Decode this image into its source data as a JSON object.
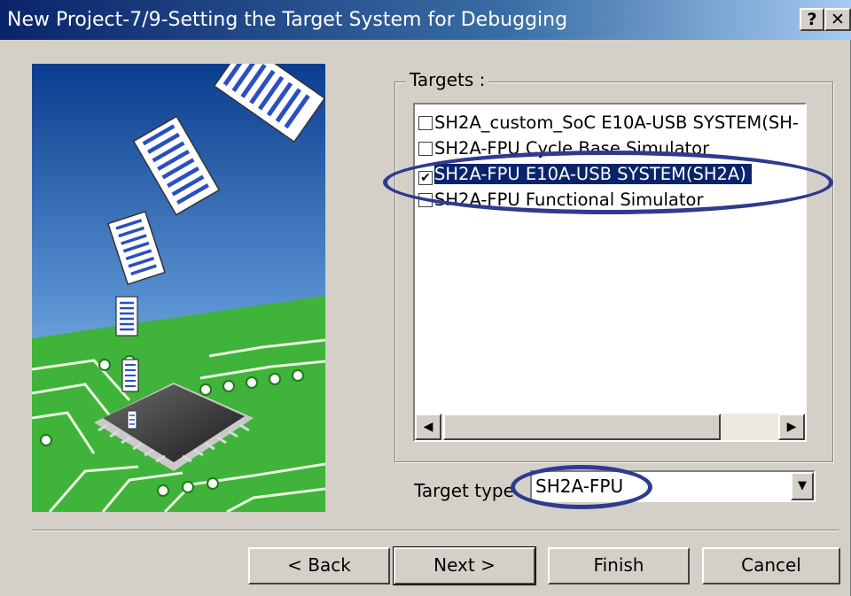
{
  "window": {
    "title": "New Project-7/9-Setting the Target System for Debugging",
    "help_label": "?",
    "close_label": "✕"
  },
  "illustration": {
    "icon": "documents-to-chip-illustration",
    "colors": {
      "sky_top": "#0a3d8f",
      "sky_bottom": "#cfe3f5",
      "board": "#3fb33a",
      "chip": "#3a3a3a"
    }
  },
  "targets": {
    "group_label": "Targets :",
    "items": [
      {
        "label": "SH2A_custom_SoC E10A-USB SYSTEM(SH-",
        "checked": false,
        "selected": false,
        "check_mark": ""
      },
      {
        "label": "SH2A-FPU Cycle Base Simulator",
        "checked": false,
        "selected": false,
        "check_mark": ""
      },
      {
        "label": "SH2A-FPU E10A-USB SYSTEM(SH2A)",
        "checked": true,
        "selected": true,
        "check_mark": "✔"
      },
      {
        "label": "SH2A-FPU Functional Simulator",
        "checked": false,
        "selected": false,
        "check_mark": ""
      }
    ],
    "scroll_left_icon": "◀",
    "scroll_right_icon": "▶"
  },
  "target_type": {
    "label": "Target type",
    "value": "SH2A-FPU",
    "dropdown_icon": "▼"
  },
  "buttons": {
    "back": "< Back",
    "next": "Next >",
    "finish": "Finish",
    "cancel": "Cancel"
  },
  "annotation_color": "#2f3a8f"
}
